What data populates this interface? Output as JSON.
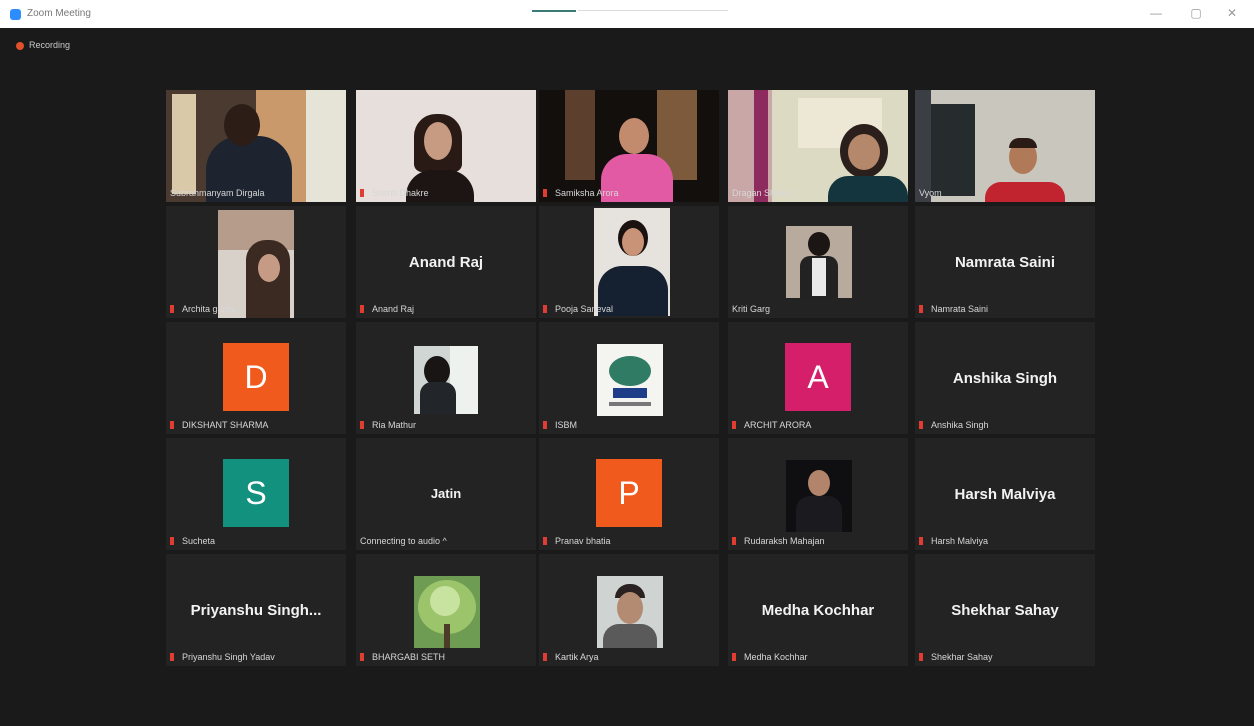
{
  "window": {
    "title": "Zoom Meeting",
    "recording_label": "Recording"
  },
  "colors": {
    "speaker_outline": "#c6e03a",
    "mute": "#e03c31",
    "avatar_d": "#f05a1c",
    "avatar_a": "#d61f6a",
    "avatar_s": "#13917f",
    "avatar_p": "#f05a1c"
  },
  "participants": [
    {
      "label": "Subrahmanyam Dirgala",
      "muted": false,
      "speaker": true,
      "view": "video"
    },
    {
      "label": "Srishti Dhakre",
      "muted": true,
      "view": "video"
    },
    {
      "label": "Samiksha Arora",
      "muted": true,
      "view": "video"
    },
    {
      "label": "Dragan Shekar",
      "muted": false,
      "view": "video"
    },
    {
      "label": "Vyom",
      "muted": false,
      "view": "video"
    },
    {
      "label": "Archita gupta",
      "muted": true,
      "view": "photo"
    },
    {
      "label": "Anand Raj",
      "muted": true,
      "center": "Anand Raj",
      "view": "name"
    },
    {
      "label": "Pooja Saneval",
      "muted": true,
      "view": "photo"
    },
    {
      "label": "Kriti Garg",
      "muted": false,
      "view": "photo"
    },
    {
      "label": "Namrata Saini",
      "muted": true,
      "center": "Namrata Saini",
      "view": "name"
    },
    {
      "label": "DIKSHANT SHARMA",
      "muted": true,
      "letter": "D",
      "view": "letter"
    },
    {
      "label": "Ria Mathur",
      "muted": true,
      "view": "photo"
    },
    {
      "label": "ISBM",
      "muted": true,
      "view": "logo"
    },
    {
      "label": "ARCHIT ARORA",
      "muted": true,
      "letter": "A",
      "view": "letter"
    },
    {
      "label": "Anshika Singh",
      "muted": true,
      "center": "Anshika Singh",
      "view": "name"
    },
    {
      "label": "Sucheta",
      "muted": true,
      "letter": "S",
      "view": "letter"
    },
    {
      "label": "Connecting to audio ^",
      "muted": false,
      "center": "Jatin",
      "view": "name"
    },
    {
      "label": "Pranav bhatia",
      "muted": true,
      "letter": "P",
      "view": "letter"
    },
    {
      "label": "Rudaraksh Mahajan",
      "muted": true,
      "view": "photo"
    },
    {
      "label": "Harsh Malviya",
      "muted": true,
      "center": "Harsh Malviya",
      "view": "name"
    },
    {
      "label": "Priyanshu Singh Yadav",
      "muted": true,
      "center": "Priyanshu Singh...",
      "view": "name"
    },
    {
      "label": "BHARGABI SETH",
      "muted": true,
      "view": "photo"
    },
    {
      "label": "Kartik Arya",
      "muted": true,
      "view": "photo"
    },
    {
      "label": "Medha Kochhar",
      "muted": true,
      "center": "Medha Kochhar",
      "view": "name"
    },
    {
      "label": "Shekhar Sahay",
      "muted": true,
      "center": "Shekhar Sahay",
      "view": "name"
    }
  ]
}
